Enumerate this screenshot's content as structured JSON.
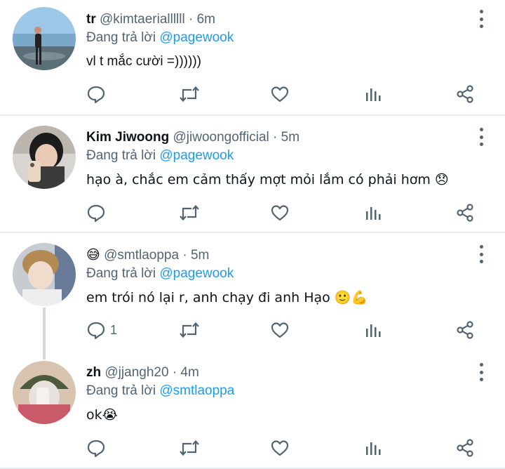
{
  "replying_to_label": "Đang trả lời",
  "tweets": [
    {
      "name": "tr",
      "handle": "@kimtaeriallllll",
      "time": "6m",
      "reply_to": "@pagewook",
      "text": "vl t mắc cười =))))))",
      "reply_count": ""
    },
    {
      "name": "Kim Jiwoong",
      "handle": "@jiwoongofficial",
      "time": "5m",
      "reply_to": "@pagewook",
      "text": "hạo à, chắc em cảm thấy mợt mỏi lắm có phải hơm 😞",
      "reply_count": ""
    },
    {
      "name": "😅",
      "handle": "@smtlaoppa",
      "time": "5m",
      "reply_to": "@pagewook",
      "text": "em trói nó lại r, anh chạy đi anh Hạo 🙂💪",
      "reply_count": "1"
    },
    {
      "name": "zh",
      "handle": "@jjangh20",
      "time": "4m",
      "reply_to": "@smtlaoppa",
      "text": "ok😭",
      "reply_count": ""
    }
  ],
  "colors": {
    "accent": "#1d9bf0",
    "secondary_text": "#536471",
    "divider": "#e6ecf0"
  },
  "icons": [
    "reply-icon",
    "retweet-icon",
    "like-icon",
    "analytics-icon",
    "share-icon",
    "more-options-icon"
  ]
}
